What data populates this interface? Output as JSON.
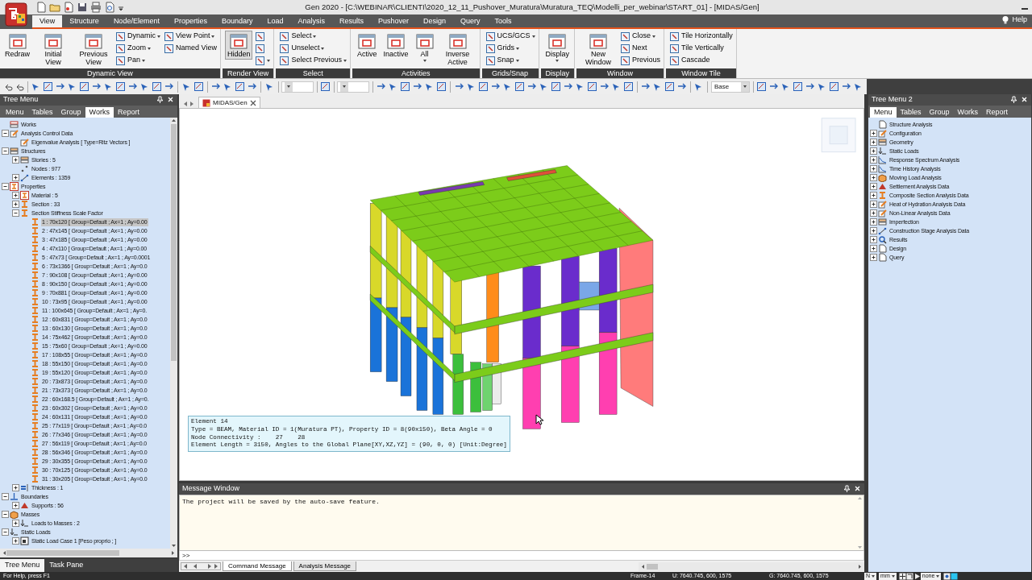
{
  "window": {
    "title": "Gen 2020 - [C:\\WEBINAR\\CLIENTI\\2020_12_11_Pushover_Muratura\\Muratura_TEQ\\Modelli_per_webinar\\START_01] - [MIDAS/Gen]"
  },
  "ribbon_tabs": [
    {
      "label": "View",
      "selected": true
    },
    {
      "label": "Structure",
      "selected": false
    },
    {
      "label": "Node/Element",
      "selected": false
    },
    {
      "label": "Properties",
      "selected": false
    },
    {
      "label": "Boundary",
      "selected": false
    },
    {
      "label": "Load",
      "selected": false
    },
    {
      "label": "Analysis",
      "selected": false
    },
    {
      "label": "Results",
      "selected": false
    },
    {
      "label": "Pushover",
      "selected": false
    },
    {
      "label": "Design",
      "selected": false
    },
    {
      "label": "Query",
      "selected": false
    },
    {
      "label": "Tools",
      "selected": false
    }
  ],
  "help": {
    "label": "Help"
  },
  "ribbon_groups": [
    {
      "label": "Dynamic View",
      "items": [
        {
          "kind": "large",
          "label": "Redraw",
          "dropdown": false
        },
        {
          "kind": "large",
          "label": "Initial View",
          "dropdown": false
        },
        {
          "kind": "large",
          "label": "Previous View",
          "dropdown": false
        },
        {
          "kind": "small",
          "label": "Dynamic",
          "dropdown": true
        },
        {
          "kind": "small",
          "label": "Zoom",
          "dropdown": true
        },
        {
          "kind": "small",
          "label": "Pan",
          "dropdown": true
        },
        {
          "kind": "small",
          "label": "View Point",
          "dropdown": true
        },
        {
          "kind": "small",
          "label": "Named View",
          "dropdown": false
        }
      ]
    },
    {
      "label": "Render View",
      "items": [
        {
          "kind": "large",
          "label": "Hidden",
          "dropdown": false,
          "pressed": true
        },
        {
          "kind": "small",
          "dropdown": false,
          "pressed": false
        },
        {
          "kind": "small",
          "dropdown": false,
          "pressed": false
        },
        {
          "kind": "small",
          "dropdown": true,
          "pressed": false
        }
      ]
    },
    {
      "label": "Select",
      "items": [
        {
          "kind": "small",
          "label": "Select",
          "dropdown": true
        },
        {
          "kind": "small",
          "label": "Unselect",
          "dropdown": true
        },
        {
          "kind": "small",
          "label": "Select Previous",
          "dropdown": true
        }
      ]
    },
    {
      "label": "Activities",
      "items": [
        {
          "kind": "large",
          "label": "Active",
          "dropdown": false
        },
        {
          "kind": "large",
          "label": "Inactive",
          "dropdown": false
        },
        {
          "kind": "large",
          "label": "All",
          "dropdown": true
        },
        {
          "kind": "large",
          "label": "Inverse Active",
          "dropdown": false
        }
      ]
    },
    {
      "label": "Grids/Snap",
      "items": [
        {
          "kind": "small",
          "label": "UCS/GCS",
          "dropdown": true
        },
        {
          "kind": "small",
          "label": "Grids",
          "dropdown": true
        },
        {
          "kind": "small",
          "label": "Snap",
          "dropdown": true
        }
      ]
    },
    {
      "label": "Display",
      "items": [
        {
          "kind": "large",
          "label": "Display",
          "dropdown": true
        }
      ]
    },
    {
      "label": "Window",
      "items": [
        {
          "kind": "large",
          "label": "New Window",
          "dropdown": false
        },
        {
          "kind": "small",
          "label": "Close",
          "dropdown": true
        },
        {
          "kind": "small",
          "label": "Next",
          "dropdown": false
        },
        {
          "kind": "small",
          "label": "Previous",
          "dropdown": false
        }
      ]
    },
    {
      "label": "Window Tile",
      "items": [
        {
          "kind": "small",
          "label": "Tile Horizontally",
          "dropdown": false
        },
        {
          "kind": "small",
          "label": "Tile Vertically",
          "dropdown": false
        },
        {
          "kind": "small",
          "label": "Cascade",
          "dropdown": false
        }
      ]
    }
  ],
  "toolbar": {
    "layer_combo": {
      "value": "Base"
    }
  },
  "left_panel": {
    "title": "Tree Menu",
    "tabs": [
      {
        "label": "Menu",
        "selected": false
      },
      {
        "label": "Tables",
        "selected": false
      },
      {
        "label": "Group",
        "selected": false
      },
      {
        "label": "Works",
        "selected": true
      },
      {
        "label": "Report",
        "selected": false
      }
    ],
    "tree": [
      {
        "label": "Works",
        "kind": "works",
        "selected": false,
        "children": [
          {
            "label": "Analysis Control Data",
            "kind": "edit",
            "expanded": true,
            "selected": false,
            "children": [
              {
                "label": "Eigenvalue Analysis [ Type=Ritz Vectors ]",
                "kind": "edit",
                "selected": false
              }
            ]
          },
          {
            "label": "Structures",
            "kind": "structure",
            "expanded": true,
            "selected": false,
            "children": [
              {
                "label": "Stories : 5",
                "kind": "structure",
                "expanded": false,
                "selected": false
              },
              {
                "label": "Nodes : 977",
                "kind": "nodes",
                "selected": false
              },
              {
                "label": "Elements : 1359",
                "kind": "elements",
                "expanded": false,
                "selected": false
              }
            ]
          },
          {
            "label": "Properties",
            "kind": "properties",
            "expanded": true,
            "selected": false,
            "children": [
              {
                "label": "Material : 5",
                "kind": "properties",
                "expanded": false,
                "selected": false
              },
              {
                "label": "Section : 33",
                "kind": "section",
                "expanded": false,
                "selected": false
              },
              {
                "label": "Section Stiffness Scale Factor",
                "kind": "section",
                "expanded": true,
                "selected": false,
                "children": [
                  {
                    "label": "1 : 70x120 [ Group=Default ; Ax=1 ; Ay=0.00",
                    "kind": "section",
                    "selected": true
                  },
                  {
                    "label": "2 : 47x145 [ Group=Default ; Ax=1 ; Ay=0.00",
                    "kind": "section",
                    "selected": false
                  },
                  {
                    "label": "3 : 47x185 [ Group=Default ; Ax=1 ; Ay=0.00",
                    "kind": "section",
                    "selected": false
                  },
                  {
                    "label": "4 : 47x110 [ Group=Default ; Ax=1 ; Ay=0.00",
                    "kind": "section",
                    "selected": false
                  },
                  {
                    "label": "5 : 47x73 [ Group=Default ; Ax=1 ; Ay=0.0001",
                    "kind": "section",
                    "selected": false
                  },
                  {
                    "label": "6 : 73x1366 [ Group=Default ; Ax=1 ; Ay=0.0",
                    "kind": "section",
                    "selected": false
                  },
                  {
                    "label": "7 : 90x108 [ Group=Default ; Ax=1 ; Ay=0.00",
                    "kind": "section",
                    "selected": false
                  },
                  {
                    "label": "8 : 90x150 [ Group=Default ; Ax=1 ; Ay=0.00",
                    "kind": "section",
                    "selected": false
                  },
                  {
                    "label": "9 : 70x881 [ Group=Default ; Ax=1 ; Ay=0.00",
                    "kind": "section",
                    "selected": false
                  },
                  {
                    "label": "10 : 73x95 [ Group=Default ; Ax=1 ; Ay=0.00",
                    "kind": "section",
                    "selected": false
                  },
                  {
                    "label": "11 : 100x645 [ Group=Default ; Ax=1 ; Ay=0.",
                    "kind": "section",
                    "selected": false
                  },
                  {
                    "label": "12 : 60x831 [ Group=Default ; Ax=1 ; Ay=0.0",
                    "kind": "section",
                    "selected": false
                  },
                  {
                    "label": "13 : 60x130 [ Group=Default ; Ax=1 ; Ay=0.0",
                    "kind": "section",
                    "selected": false
                  },
                  {
                    "label": "14 : 75x462 [ Group=Default ; Ax=1 ; Ay=0.0",
                    "kind": "section",
                    "selected": false
                  },
                  {
                    "label": "15 : 75x60 [ Group=Default ; Ax=1 ; Ay=0.00",
                    "kind": "section",
                    "selected": false
                  },
                  {
                    "label": "17 : 108x55 [ Group=Default ; Ax=1 ; Ay=0.0",
                    "kind": "section",
                    "selected": false
                  },
                  {
                    "label": "18 : 55x150 [ Group=Default ; Ax=1 ; Ay=0.0",
                    "kind": "section",
                    "selected": false
                  },
                  {
                    "label": "19 : 55x120 [ Group=Default ; Ax=1 ; Ay=0.0",
                    "kind": "section",
                    "selected": false
                  },
                  {
                    "label": "20 : 73x873 [ Group=Default ; Ax=1 ; Ay=0.0",
                    "kind": "section",
                    "selected": false
                  },
                  {
                    "label": "21 : 73x373 [ Group=Default ; Ax=1 ; Ay=0.0",
                    "kind": "section",
                    "selected": false
                  },
                  {
                    "label": "22 : 60x168.5 [ Group=Default ; Ax=1 ; Ay=0.",
                    "kind": "section",
                    "selected": false
                  },
                  {
                    "label": "23 : 60x302 [ Group=Default ; Ax=1 ; Ay=0.0",
                    "kind": "section",
                    "selected": false
                  },
                  {
                    "label": "24 : 60x131 [ Group=Default ; Ax=1 ; Ay=0.0",
                    "kind": "section",
                    "selected": false
                  },
                  {
                    "label": "25 : 77x119 [ Group=Default ; Ax=1 ; Ay=0.0",
                    "kind": "section",
                    "selected": false
                  },
                  {
                    "label": "26 : 77x346 [ Group=Default ; Ax=1 ; Ay=0.0",
                    "kind": "section",
                    "selected": false
                  },
                  {
                    "label": "27 : 56x119 [ Group=Default ; Ax=1 ; Ay=0.0",
                    "kind": "section",
                    "selected": false
                  },
                  {
                    "label": "28 : 56x346 [ Group=Default ; Ax=1 ; Ay=0.0",
                    "kind": "section",
                    "selected": false
                  },
                  {
                    "label": "29 : 30x355 [ Group=Default ; Ax=1 ; Ay=0.0",
                    "kind": "section",
                    "selected": false
                  },
                  {
                    "label": "30 : 70x125 [ Group=Default ; Ax=1 ; Ay=0.0",
                    "kind": "section",
                    "selected": false
                  },
                  {
                    "label": "31 : 30x205 [ Group=Default ; Ax=1 ; Ay=0.0",
                    "kind": "section",
                    "selected": false
                  }
                ]
              },
              {
                "label": "Thickness : 1",
                "kind": "thickness",
                "expanded": false,
                "selected": false
              }
            ]
          },
          {
            "label": "Boundaries",
            "kind": "boundary",
            "expanded": true,
            "selected": false,
            "children": [
              {
                "label": "Supports : 56",
                "kind": "support",
                "expanded": false,
                "selected": false
              }
            ]
          },
          {
            "label": "Masses",
            "kind": "mass",
            "expanded": true,
            "selected": false,
            "children": [
              {
                "label": "Loads to Masses : 2",
                "kind": "load",
                "expanded": false,
                "selected": false
              }
            ]
          },
          {
            "label": "Static Loads",
            "kind": "load",
            "expanded": true,
            "selected": false,
            "children": [
              {
                "label": "Static Load Case 1 [Peso proprio ; ]",
                "kind": "loadcase",
                "expanded": false,
                "selected": false
              }
            ]
          }
        ]
      }
    ],
    "bottom_tabs": [
      {
        "label": "Tree Menu",
        "selected": true
      },
      {
        "label": "Task Pane",
        "selected": false
      }
    ]
  },
  "center": {
    "doc_tab": {
      "label": "MIDAS/Gen"
    },
    "tooltip": {
      "lines": [
        "Element 14",
        "Type = BEAM, Material ID = 1(Muratura PT), Property ID = 8(90x150), Beta Angle = 0",
        "Node Connectivity :    27    28",
        "Element Length = 3150, Angles to the Global Plane[XY,XZ,YZ] = (90, 0, 0) [Unit:Degree]"
      ]
    },
    "message_window": {
      "title": "Message Window",
      "text": "The project will be saved by the auto-save feature.",
      "prompt": ">>",
      "tabs": [
        {
          "label": "Command Message",
          "selected": true
        },
        {
          "label": "Analysis Message",
          "selected": false
        }
      ]
    }
  },
  "right_panel": {
    "title": "Tree Menu 2",
    "tabs": [
      {
        "label": "Menu",
        "selected": true
      },
      {
        "label": "Tables",
        "selected": false
      },
      {
        "label": "Group",
        "selected": false
      },
      {
        "label": "Works",
        "selected": false
      },
      {
        "label": "Report",
        "selected": false
      }
    ],
    "tree": [
      {
        "label": "Structure Analysis",
        "kind": "doc",
        "selected": false
      },
      {
        "label": "Configuration",
        "kind": "edit",
        "expanded": false,
        "selected": false
      },
      {
        "label": "Geometry",
        "kind": "structure",
        "expanded": false,
        "selected": false
      },
      {
        "label": "Static Loads",
        "kind": "load",
        "expanded": false,
        "selected": false
      },
      {
        "label": "Response Spectrum Analysis",
        "kind": "chart",
        "expanded": false,
        "selected": false
      },
      {
        "label": "Time History Analysis",
        "kind": "chart",
        "expanded": false,
        "selected": false
      },
      {
        "label": "Moving Load Analysis",
        "kind": "mass",
        "expanded": false,
        "selected": false
      },
      {
        "label": "Settlement Analysis Data",
        "kind": "support",
        "expanded": false,
        "selected": false
      },
      {
        "label": "Composite Section Analysis Data",
        "kind": "section",
        "expanded": false,
        "selected": false
      },
      {
        "label": "Heat of Hydration Analysis Data",
        "kind": "edit",
        "expanded": false,
        "selected": false
      },
      {
        "label": "Non-Linear Analysis Data",
        "kind": "edit",
        "expanded": false,
        "selected": false
      },
      {
        "label": "Imperfection",
        "kind": "structure",
        "expanded": false,
        "selected": false
      },
      {
        "label": "Construction Stage Analysis Data",
        "kind": "elements",
        "expanded": false,
        "selected": false
      },
      {
        "label": "Results",
        "kind": "query",
        "expanded": false,
        "selected": false
      },
      {
        "label": "Design",
        "kind": "doc",
        "expanded": false,
        "selected": false
      },
      {
        "label": "Query",
        "kind": "doc",
        "expanded": false,
        "selected": false
      }
    ]
  },
  "status_bar": {
    "help_text": "For Help, press F1",
    "frame": "Frame-14",
    "u_coords": "U: 7640.745, 600, 1575",
    "g_coords": "G: 7640.745, 600, 1575",
    "combos": [
      {
        "value": "N"
      },
      {
        "value": "mm"
      },
      {
        "value": "none"
      }
    ]
  }
}
